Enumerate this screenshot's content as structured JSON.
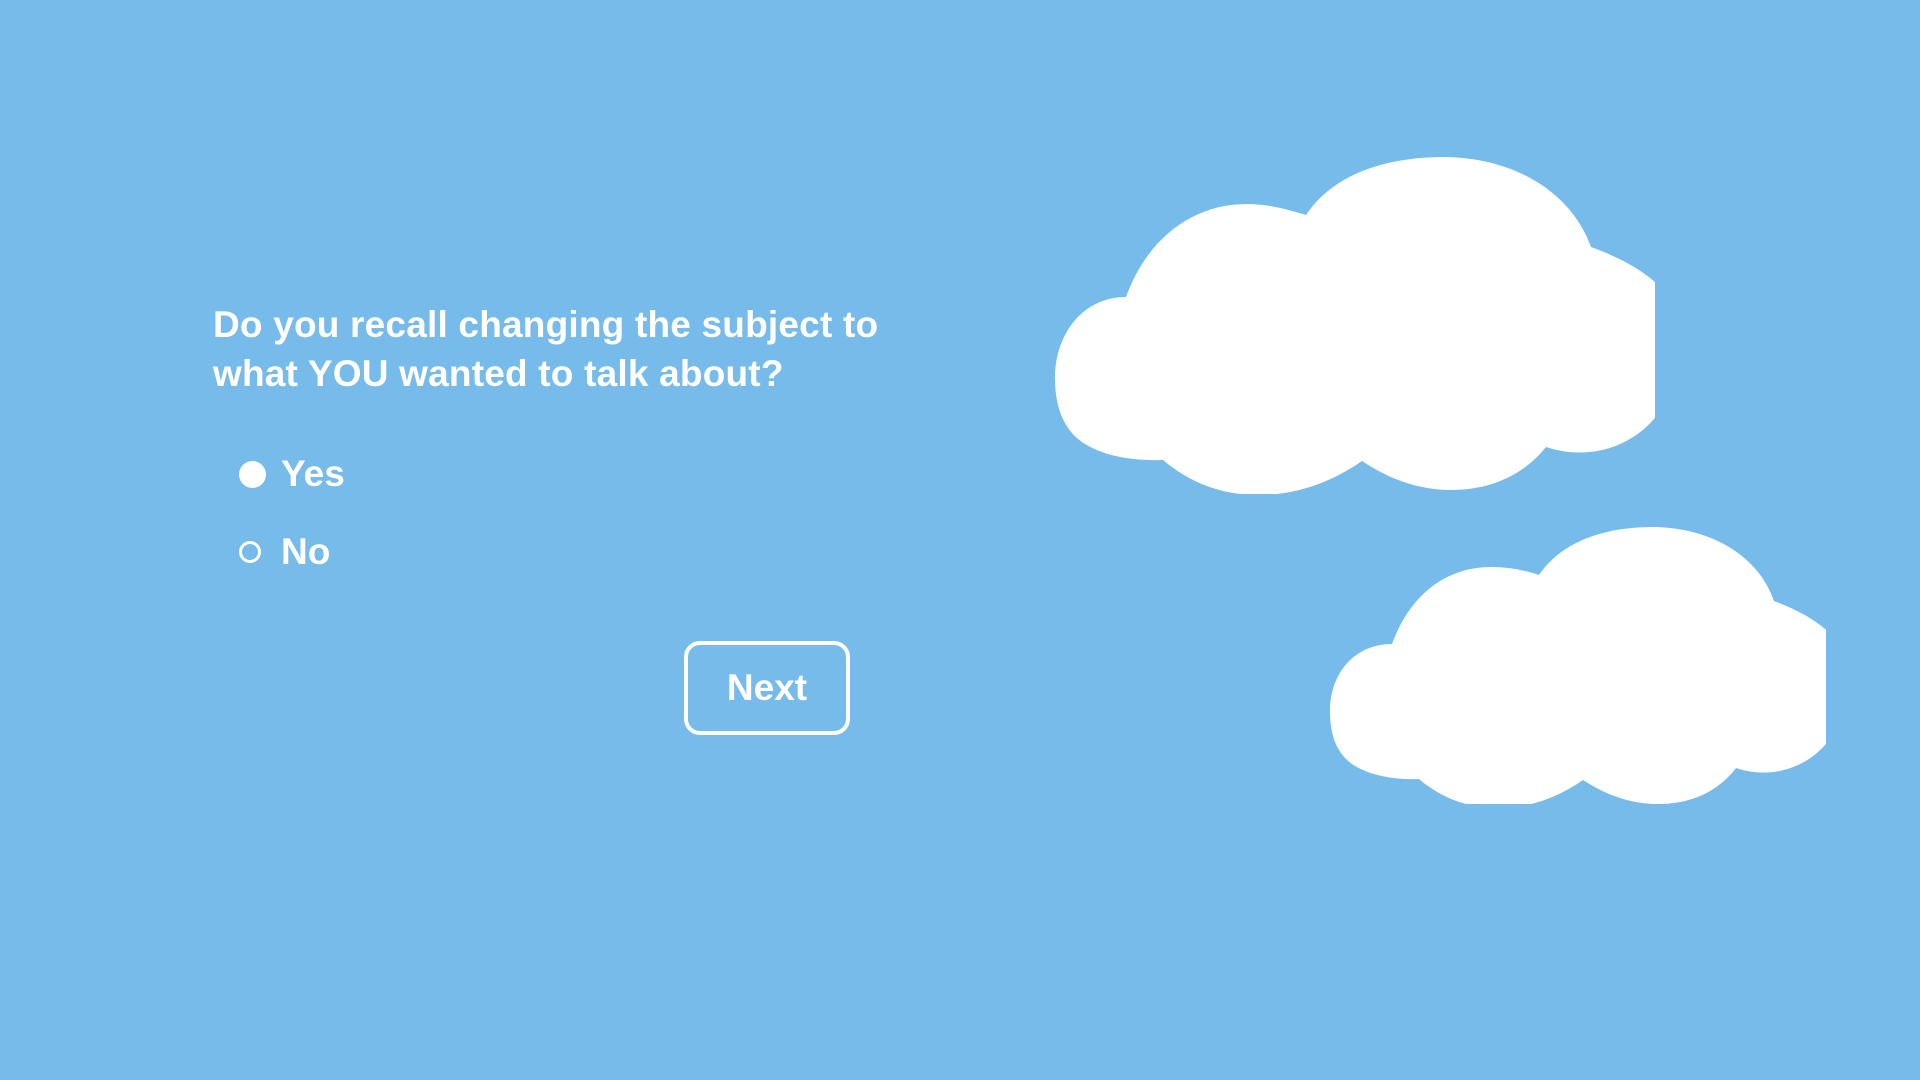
{
  "page": {
    "background_color": "#76bbea",
    "foreground_color": "#ffffff"
  },
  "survey": {
    "question": "Do you recall changing the subject to what YOU wanted to talk about?",
    "options": [
      {
        "label": "Yes",
        "selected": true
      },
      {
        "label": "No",
        "selected": false
      }
    ],
    "next_label": "Next"
  },
  "decorations": {
    "clouds": [
      "cloud-large",
      "cloud-small"
    ]
  }
}
